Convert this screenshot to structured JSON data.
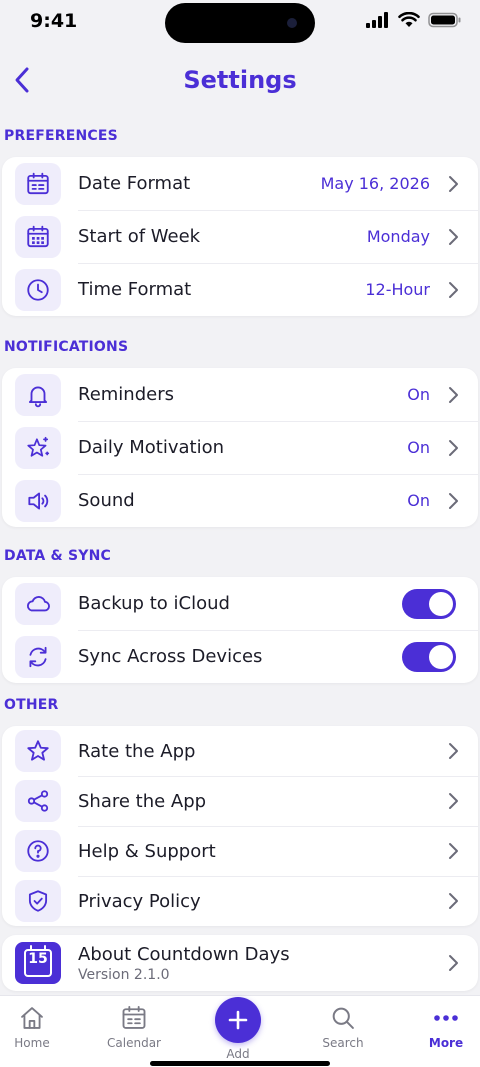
{
  "status_bar": {
    "time": "9:41"
  },
  "header": {
    "title": "Settings"
  },
  "colors": {
    "accent": "#4b2fd6",
    "icon_bg": "#efedfb",
    "background": "#f2f2f5"
  },
  "sections": {
    "preferences": {
      "label": "PREFERENCES",
      "items": [
        {
          "label": "Date Format",
          "value": "May 16, 2026",
          "icon": "calendar-icon"
        },
        {
          "label": "Start of Week",
          "value": "Monday",
          "icon": "calendar-grid-icon"
        },
        {
          "label": "Time Format",
          "value": "12-Hour",
          "icon": "clock-icon"
        }
      ]
    },
    "notifications": {
      "label": "NOTIFICATIONS",
      "items": [
        {
          "label": "Reminders",
          "value": "On",
          "icon": "bell-icon"
        },
        {
          "label": "Daily Motivation",
          "value": "On",
          "icon": "sparkle-star-icon"
        },
        {
          "label": "Sound",
          "value": "On",
          "icon": "speaker-icon"
        }
      ]
    },
    "data_sync": {
      "label": "DATA & SYNC",
      "items": [
        {
          "label": "Backup to iCloud",
          "enabled": true,
          "icon": "cloud-icon"
        },
        {
          "label": "Sync Across Devices",
          "enabled": true,
          "icon": "sync-icon"
        }
      ]
    },
    "other": {
      "label": "OTHER",
      "items": [
        {
          "label": "Rate the App",
          "icon": "star-icon"
        },
        {
          "label": "Share the App",
          "icon": "share-icon"
        },
        {
          "label": "Help & Support",
          "icon": "help-icon"
        },
        {
          "label": "Privacy Policy",
          "icon": "shield-check-icon"
        }
      ]
    }
  },
  "about": {
    "title": "About Countdown Days",
    "version": "Version 2.1.0",
    "icon_number": "15",
    "icon": "app-calendar-icon"
  },
  "tab_bar": {
    "tabs": [
      {
        "label": "Home",
        "icon": "home-icon",
        "active": false
      },
      {
        "label": "Calendar",
        "icon": "calendar-icon",
        "active": false
      },
      {
        "label": "Add",
        "icon": "plus-icon",
        "active": false
      },
      {
        "label": "Search",
        "icon": "search-icon",
        "active": false
      },
      {
        "label": "More",
        "icon": "more-dots-icon",
        "active": true
      }
    ]
  }
}
